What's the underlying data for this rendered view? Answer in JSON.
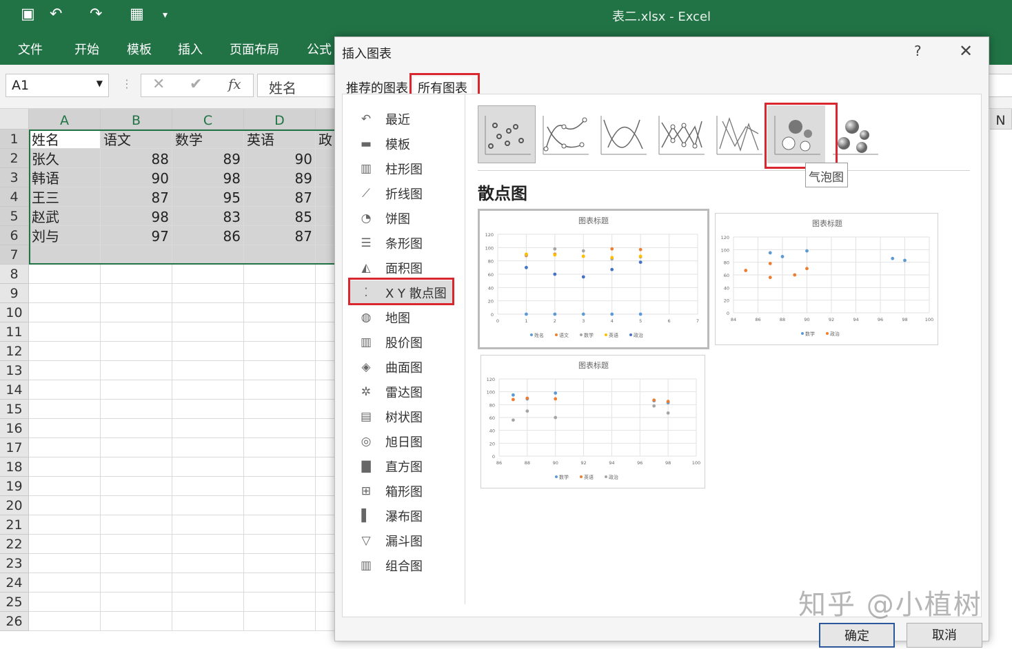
{
  "window_title": "表二.xlsx  -  Excel",
  "ribbon_tabs": [
    "文件",
    "开始",
    "模板",
    "插入",
    "页面布局",
    "公式"
  ],
  "name_box": "A1",
  "formula_value": "姓名",
  "columns": [
    "A",
    "B",
    "C",
    "D",
    "N"
  ],
  "header_row": [
    "姓名",
    "语文",
    "数学",
    "英语",
    "政"
  ],
  "rows": [
    [
      "张久",
      "88",
      "89",
      "90"
    ],
    [
      "韩语",
      "90",
      "98",
      "89"
    ],
    [
      "王三",
      "87",
      "95",
      "87"
    ],
    [
      "赵武",
      "98",
      "83",
      "85"
    ],
    [
      "刘与",
      "97",
      "86",
      "87"
    ]
  ],
  "row_numbers": [
    "1",
    "2",
    "3",
    "4",
    "5",
    "6",
    "7",
    "8",
    "9",
    "10",
    "11",
    "12",
    "13",
    "14",
    "15",
    "16",
    "17",
    "18",
    "19",
    "20",
    "21",
    "22",
    "23",
    "24",
    "25",
    "26"
  ],
  "dialog": {
    "title": "插入图表",
    "help": "?",
    "close": "✕",
    "tabs": [
      "推荐的图表",
      "所有图表"
    ],
    "chart_types": [
      "最近",
      "模板",
      "柱形图",
      "折线图",
      "饼图",
      "条形图",
      "面积图",
      "X Y 散点图",
      "地图",
      "股价图",
      "曲面图",
      "雷达图",
      "树状图",
      "旭日图",
      "直方图",
      "箱形图",
      "瀑布图",
      "漏斗图",
      "组合图"
    ],
    "selected_type": "X Y 散点图",
    "section_title": "散点图",
    "tooltip": "气泡图",
    "ok": "确定",
    "cancel": "取消"
  },
  "watermark": "知乎 @小植树",
  "chart_data": [
    {
      "type": "scatter",
      "title": "图表标题",
      "xlim": [
        0,
        7
      ],
      "ylim": [
        0,
        120
      ],
      "xticks": [
        "0",
        "1",
        "2",
        "3",
        "4",
        "5",
        "6",
        "7"
      ],
      "yticks": [
        "0",
        "20",
        "40",
        "60",
        "80",
        "100",
        "120"
      ],
      "legend": "bottom",
      "series": [
        {
          "name": "姓名",
          "color": "#5b9bd5",
          "points": [
            [
              1,
              0
            ],
            [
              2,
              0
            ],
            [
              3,
              0
            ],
            [
              4,
              0
            ],
            [
              5,
              0
            ]
          ]
        },
        {
          "name": "语文",
          "color": "#ed7d31",
          "points": [
            [
              1,
              88
            ],
            [
              2,
              90
            ],
            [
              3,
              87
            ],
            [
              4,
              98
            ],
            [
              5,
              97
            ]
          ]
        },
        {
          "name": "数学",
          "color": "#a5a5a5",
          "points": [
            [
              1,
              89
            ],
            [
              2,
              98
            ],
            [
              3,
              95
            ],
            [
              4,
              83
            ],
            [
              5,
              86
            ]
          ]
        },
        {
          "name": "英语",
          "color": "#ffc000",
          "points": [
            [
              1,
              90
            ],
            [
              2,
              89
            ],
            [
              3,
              87
            ],
            [
              4,
              85
            ],
            [
              5,
              87
            ]
          ]
        },
        {
          "name": "政治",
          "color": "#4472c4",
          "points": [
            [
              1,
              70
            ],
            [
              2,
              60
            ],
            [
              3,
              56
            ],
            [
              4,
              67
            ],
            [
              5,
              78
            ]
          ]
        }
      ]
    },
    {
      "type": "scatter",
      "title": "图表标题",
      "xlim": [
        84,
        100
      ],
      "ylim": [
        0,
        120
      ],
      "xticks": [
        "84",
        "86",
        "88",
        "90",
        "92",
        "94",
        "96",
        "98",
        "100"
      ],
      "yticks": [
        "0",
        "20",
        "40",
        "60",
        "80",
        "100",
        "120"
      ],
      "legend": "bottom",
      "series": [
        {
          "name": "数学",
          "color": "#5b9bd5",
          "points": [
            [
              87,
              95
            ],
            [
              88,
              89
            ],
            [
              90,
              98
            ],
            [
              97,
              86
            ],
            [
              98,
              83
            ]
          ]
        },
        {
          "name": "政治",
          "color": "#ed7d31",
          "points": [
            [
              85,
              67
            ],
            [
              87,
              56
            ],
            [
              87,
              78
            ],
            [
              89,
              60
            ],
            [
              90,
              70
            ]
          ]
        }
      ]
    },
    {
      "type": "scatter",
      "title": "图表标题",
      "xlim": [
        86,
        100
      ],
      "ylim": [
        0,
        120
      ],
      "xticks": [
        "86",
        "88",
        "90",
        "92",
        "94",
        "96",
        "98",
        "100"
      ],
      "yticks": [
        "0",
        "20",
        "40",
        "60",
        "80",
        "100",
        "120"
      ],
      "legend": "bottom",
      "series": [
        {
          "name": "数学",
          "color": "#5b9bd5",
          "points": [
            [
              87,
              95
            ],
            [
              88,
              89
            ],
            [
              90,
              98
            ],
            [
              97,
              86
            ],
            [
              98,
              83
            ]
          ]
        },
        {
          "name": "英语",
          "color": "#ed7d31",
          "points": [
            [
              87,
              88
            ],
            [
              88,
              90
            ],
            [
              90,
              89
            ],
            [
              97,
              87
            ],
            [
              98,
              85
            ]
          ]
        },
        {
          "name": "政治",
          "color": "#a5a5a5",
          "points": [
            [
              87,
              56
            ],
            [
              88,
              70
            ],
            [
              90,
              60
            ],
            [
              97,
              78
            ],
            [
              98,
              67
            ]
          ]
        }
      ]
    }
  ]
}
